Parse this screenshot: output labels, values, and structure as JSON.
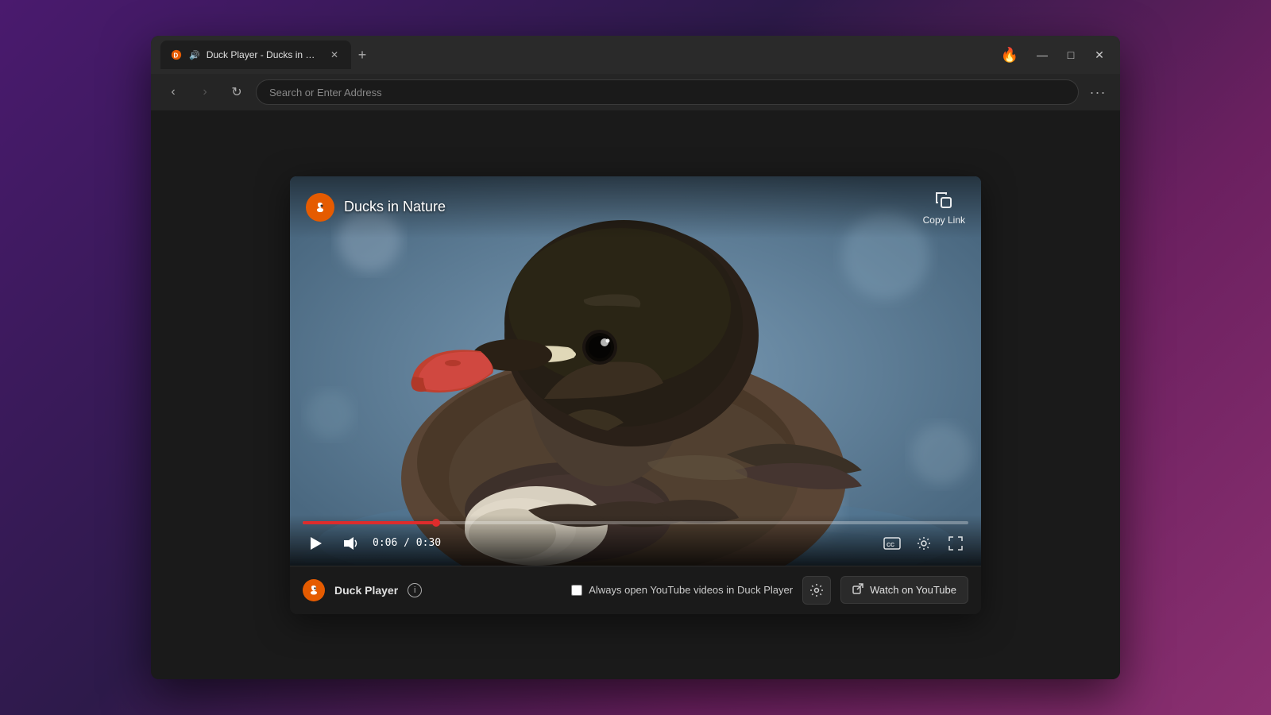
{
  "browser": {
    "tab": {
      "title": "Duck Player - Ducks in Nature",
      "favicon": "duck-player-favicon",
      "audio_playing": true
    },
    "new_tab_button": "+",
    "window_controls": {
      "minimize": "—",
      "maximize": "□",
      "close": "✕"
    },
    "navigation": {
      "back_label": "‹",
      "forward_label": "›",
      "refresh_label": "↻",
      "address_placeholder": "Search or Enter Address",
      "menu_label": "···"
    }
  },
  "video": {
    "title": "Ducks in Nature",
    "copy_link_label": "Copy Link",
    "progress_percent": 20,
    "time_current": "0:06",
    "time_total": "0:30",
    "time_display": "0:06 / 0:30"
  },
  "footer": {
    "duck_player_label": "Duck Player",
    "info_icon": "ⓘ",
    "checkbox_label": "Always open YouTube videos in Duck Player",
    "watch_youtube_label": "Watch on YouTube",
    "settings_icon": "⚙"
  },
  "controls": {
    "play_icon": "▶",
    "volume_icon": "🔊",
    "captions_icon": "CC",
    "settings_icon": "⚙",
    "fullscreen_icon": "⛶"
  },
  "colors": {
    "progress_fill": "#de2c2c",
    "ddg_orange": "#e55b00",
    "background_dark": "#1a1a1a",
    "video_bg": "#3a4a5a"
  }
}
